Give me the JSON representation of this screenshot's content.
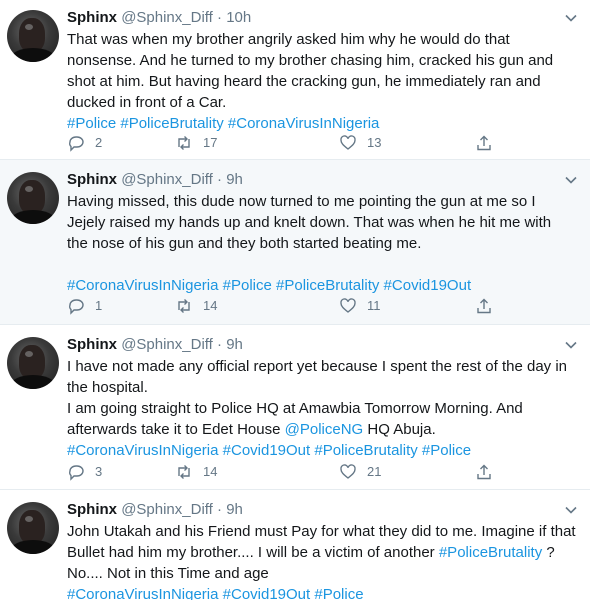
{
  "tweets": [
    {
      "name": "Sphinx",
      "handle": "@Sphinx_Diff",
      "dot": "·",
      "time": "10h",
      "lines": [
        "That was when my brother angrily asked him why he would do that",
        "nonsense. And he turned to my brother chasing him, cracked his gun and",
        "shot at him. But having heard the cracking gun, he immediately ran and",
        "ducked in front of a Car."
      ],
      "hashtags": "#Police #PoliceBrutality #CoronaVirusInNigeria",
      "replies": "2",
      "retweets": "17",
      "likes": "13"
    },
    {
      "name": "Sphinx",
      "handle": "@Sphinx_Diff",
      "dot": "·",
      "time": "9h",
      "lines": [
        "Having missed, this dude now turned to me pointing the gun at me so I",
        "Jejely raised my hands up and knelt down.  That was when he hit me with",
        "the nose of his gun and they both started beating me."
      ],
      "hashtags": "#CoronaVirusInNigeria #Police #PoliceBrutality #Covid19Out",
      "replies": "1",
      "retweets": "14",
      "likes": "11"
    },
    {
      "name": "Sphinx",
      "handle": "@Sphinx_Diff",
      "dot": "·",
      "time": "9h",
      "lines": [
        "I have not made any official report yet because I spent the rest of the day in",
        "the hospital.",
        "I am going straight to Police HQ at Amawbia Tomorrow Morning. And"
      ],
      "line4_pre": "afterwards take it to Edet House ",
      "line4_mention": "@PoliceNG",
      "line4_post": " HQ Abuja.",
      "hashtags": "#CoronaVirusInNigeria #Covid19Out #PoliceBrutality #Police",
      "replies": "3",
      "retweets": "14",
      "likes": "21"
    },
    {
      "name": "Sphinx",
      "handle": "@Sphinx_Diff",
      "dot": "·",
      "time": "9h",
      "line1": "John Utakah and his Friend must Pay for what they did to me. Imagine if that",
      "line2_pre": "Bullet had him my brother.... I will be a victim of another ",
      "line2_tag": "#PoliceBrutality",
      "line2_post": " ?",
      "line3": "No.... Not in this Time and age",
      "hashtags": "#CoronaVirusInNigeria #Covid19Out #Police"
    }
  ],
  "icons": {
    "reply": "reply-icon",
    "retweet": "retweet-icon",
    "like": "heart-icon",
    "share": "share-icon",
    "more": "chevron-down-icon"
  },
  "colors": {
    "link": "#1b95e0",
    "muted": "#657786",
    "text": "#14171a",
    "highlight_bg": "#f5f8fa",
    "divider": "#e6ecf0"
  }
}
